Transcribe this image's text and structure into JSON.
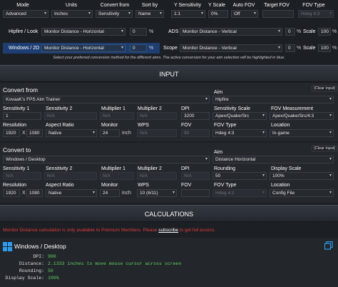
{
  "top_headers": [
    "Mode",
    "Units",
    "Convert from",
    "Sort by",
    "Y Sensitivity",
    "Y Scale",
    "Auto FOV",
    "Target FOV",
    "FOV Type"
  ],
  "top_values": {
    "mode": "Advanced",
    "units": "Inches",
    "convert_from": "Sensitivity",
    "sort_by": "Name",
    "y_sensitivity": "1:1",
    "y_scale": "0%",
    "auto_fov": "Off",
    "target_fov": "",
    "fov_type": "Hdeg 4:3"
  },
  "aim_rows": {
    "hipfire_label": "Hipfire / Look",
    "hipfire_method": "Monitor Distance - Horizontal",
    "hipfire_pct": "0",
    "ads_label": "ADS",
    "ads_method": "Monitor Distance - Vertical",
    "ads_pct": "0",
    "windows_label": "Windows / 2D",
    "windows_method": "Monitor Distance - Horizontal",
    "windows_pct": "0",
    "scope_label": "Scope",
    "scope_method": "Monitor Distance - Vertical",
    "scope_pct": "0",
    "percent": "%",
    "scale_label": "Scale",
    "ads_scale": "100",
    "scope_scale": "100",
    "hint": "Select your preferred conversion method for the different aims. The active conversion for your aim selection will be highlighted in blue."
  },
  "input_band": "INPUT",
  "convert_from": {
    "title": "Convert from",
    "clear": "(Clear input)",
    "game": "KovaaK's FPS Aim Trainer",
    "aim_label": "Aim",
    "aim": "Hipfire",
    "sens1_label": "Sensitivity 1",
    "sens1": "1",
    "sens2_label": "Sensitivity 2",
    "sens2": "N/A",
    "mult1_label": "Multiplier 1",
    "mult1": "N/A",
    "mult2_label": "Multiplier 2",
    "mult2": "N/A",
    "dpi_label": "DPI",
    "dpi": "3200",
    "sens_scale_label": "Sensitivity Scale",
    "sens_scale": "Apex/Quake/Src",
    "fov_meas_label": "FOV Measurement",
    "fov_meas": "Apex/Quake/Src/4:3",
    "res_label": "Resolution",
    "res_w": "1920",
    "res_x": "X",
    "res_h": "1080",
    "aspect_label": "Aspect Ratio",
    "aspect": "Native",
    "monitor_label": "Monitor",
    "monitor": "24",
    "inch": "inch",
    "wps_label": "WPS",
    "wps": "N/A",
    "fov_label": "FOV",
    "fov": "90",
    "fov_type_label": "FOV Type",
    "fov_type": "Hdeg 4:3",
    "location_label": "Location",
    "location": "In-game"
  },
  "convert_to": {
    "title": "Convert to",
    "clear": "(Clear input)",
    "game": "Windows / Desktop",
    "aim_label": "Aim",
    "aim": "Distance Horizontal",
    "sens1_label": "Sensitivity 1",
    "sens1": "N/A",
    "sens2_label": "Sensitivity 2",
    "sens2": "N/A",
    "mult1_label": "Multiplier 1",
    "mult1": "N/A",
    "mult2_label": "Multiplier 2",
    "mult2": "N/A",
    "dpi_label": "DPI",
    "dpi": "N/A",
    "rounding_label": "Rounding",
    "rounding": "50",
    "display_scale_label": "Display Scale",
    "display_scale": "100%",
    "res_label": "Resolution",
    "res_w": "1920",
    "res_x": "X",
    "res_h": "1080",
    "aspect_label": "Aspect Ratio",
    "aspect": "Native",
    "monitor_label": "Monitor",
    "monitor": "24",
    "inch": "inch",
    "wps_label": "WPS",
    "wps": "10 (6/11)",
    "fov_label": "FOV",
    "fov": "",
    "fov_type_label": "FOV Type",
    "fov_type": "Hdeg 4:3",
    "location_label": "Location",
    "location": "Config File"
  },
  "calc_band": "CALCULATIONS",
  "premium_notice": {
    "before": "Monitor Distance calculation is only available to Premium Members. Please ",
    "link": "subscribe",
    "after": " to get full access."
  },
  "result": {
    "title": "Windows / Desktop",
    "rows": [
      {
        "label": "DPI:",
        "value": "900"
      },
      {
        "label": "Distance:",
        "value": "2.1333 inches to move mouse cursor across screen"
      },
      {
        "label": "Rounding:",
        "value": "50"
      },
      {
        "label": "Display Scale:",
        "value": "100%"
      }
    ]
  },
  "colors": {
    "highlight": "#1e3e73",
    "accent_red": "#e23b3b",
    "result_value": "#5fd35f",
    "windows_blue": "#2d9cf0"
  }
}
